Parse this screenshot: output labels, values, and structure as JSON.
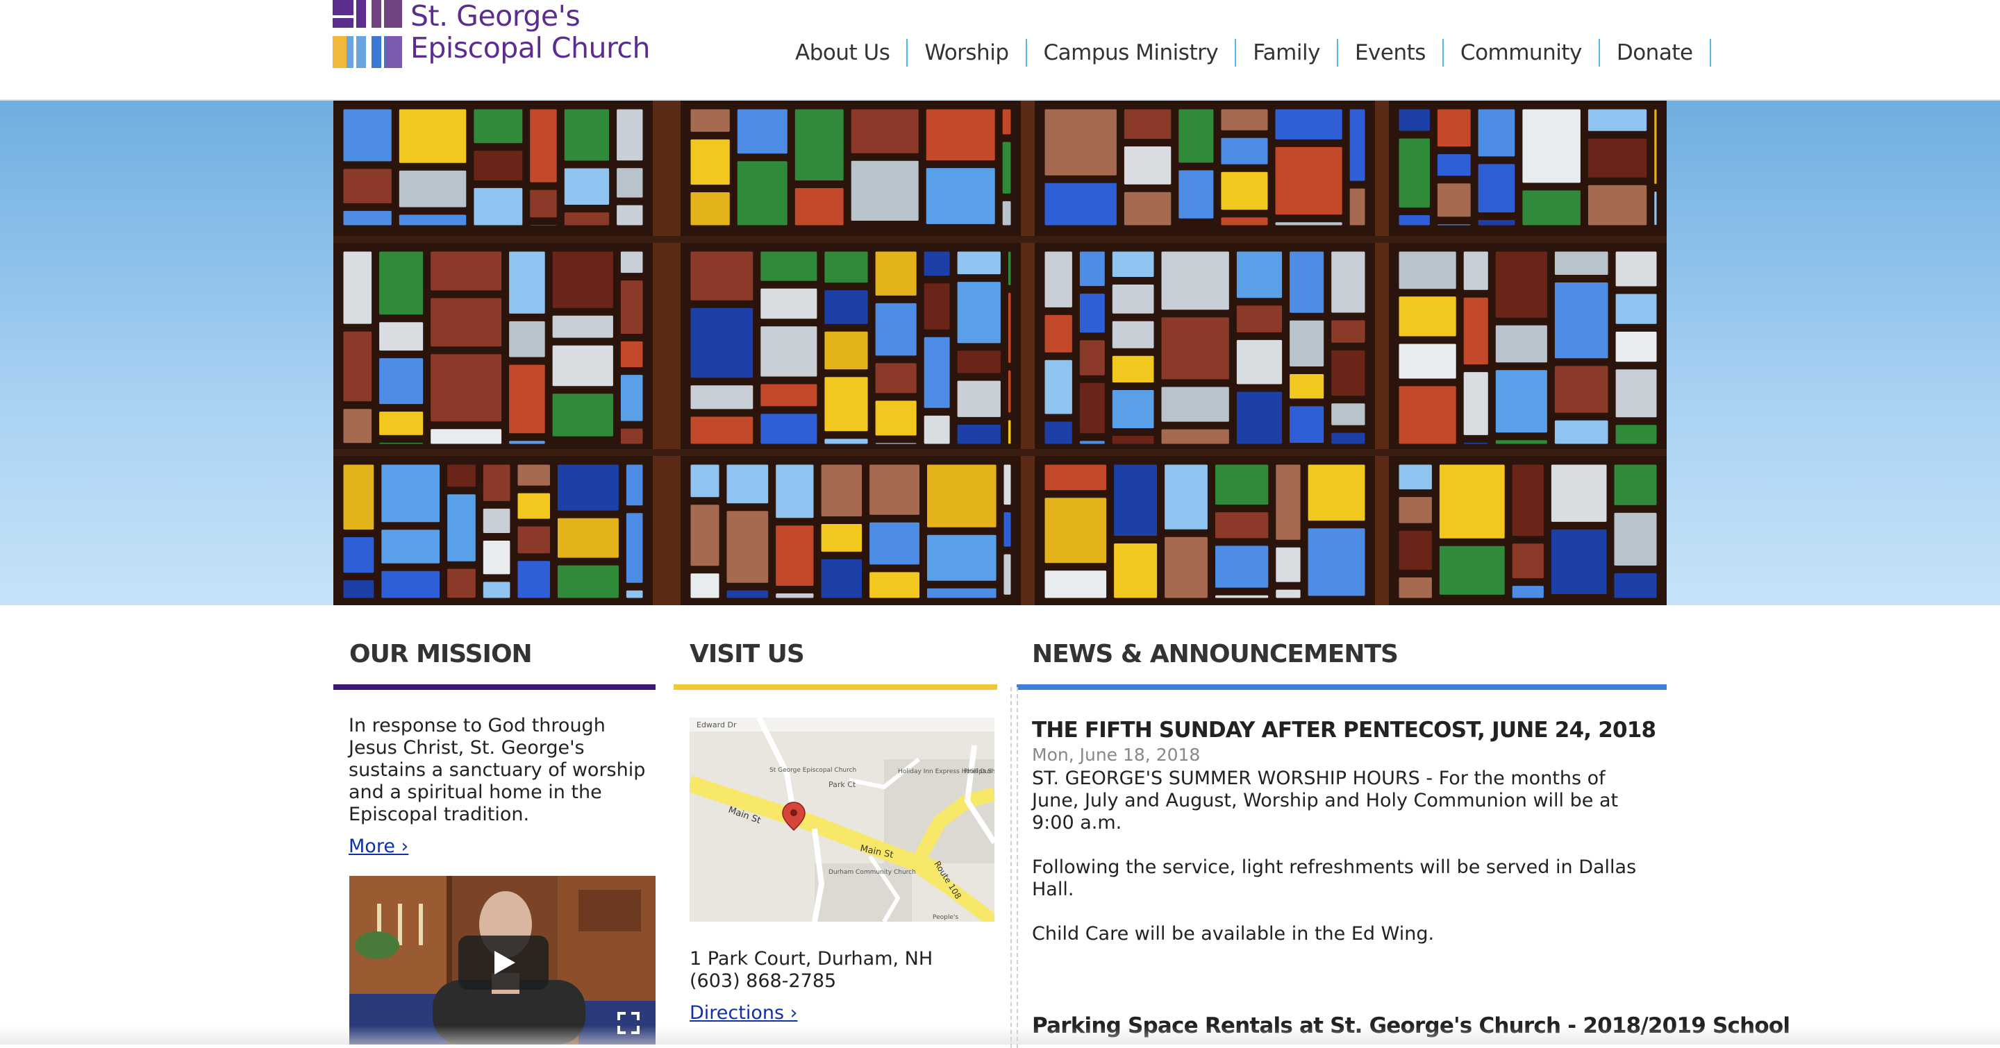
{
  "header": {
    "logo_line1": "St. George's",
    "logo_line2": "Episcopal Church",
    "nav": [
      "About Us",
      "Worship",
      "Campus Ministry",
      "Family",
      "Events",
      "Community",
      "Donate"
    ]
  },
  "mission": {
    "heading": "OUR MISSION",
    "text": "In response to God through Jesus Christ, St. George's sustains a sanctuary of worship and a spiritual home in the Episcopal tradition.",
    "more_link": "More ›",
    "accent": "#3a1878"
  },
  "visit": {
    "heading": "VISIT US",
    "address": "1 Park Court, Durham, NH",
    "phone": "(603) 868-2785",
    "directions_link": "Directions ›",
    "accent": "#f2c935",
    "map_labels": {
      "main_st_1": "Main St",
      "main_st_2": "Main St",
      "park_ct": "Park Ct",
      "route": "Route 108",
      "church_label": "St George Episcopal Church",
      "hotel_label": "Holiday Inn Express Hotel Durham",
      "community_church": "Durham Community Church",
      "top_road": "Edward Dr",
      "phillips": "Phillips S",
      "bottom_label": "People's"
    }
  },
  "news": {
    "heading": "NEWS & ANNOUNCEMENTS",
    "accent": "#3b7fd8",
    "item1_title": "THE FIFTH SUNDAY AFTER PENTECOST, JUNE 24, 2018",
    "item1_date": "Mon, June 18, 2018",
    "item1_p1": "ST. GEORGE'S SUMMER WORSHIP HOURS - For the months of June, July and August, Worship and Holy Communion will be at 9:00 a.m.",
    "item1_p2": "Following the service, light refreshments will be served in Dallas Hall.",
    "item1_p3": "Child Care will be available in the Ed Wing.",
    "item2_title": "Parking Space Rentals at St. George's Church - 2018/2019 School"
  },
  "icons": {
    "play": "play-icon",
    "fullscreen": "fullscreen-icon",
    "map_pin": "map-pin-icon"
  }
}
